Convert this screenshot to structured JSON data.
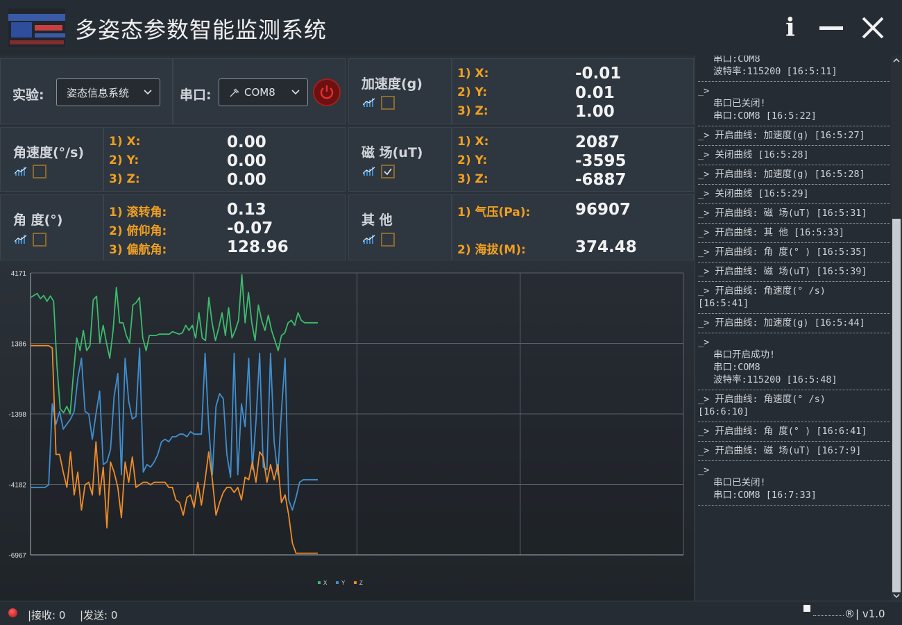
{
  "app": {
    "title": "多姿态参数智能监测系统"
  },
  "controls": {
    "experiment_label": "实验:",
    "experiment_value": "姿态信息系统",
    "port_label": "串口:",
    "port_value": "COM8"
  },
  "sensors": {
    "accel": {
      "label": "加速度(g)",
      "checked": false,
      "rows": [
        {
          "k": "1) X:",
          "v": "-0.01"
        },
        {
          "k": "2) Y:",
          "v": "0.01"
        },
        {
          "k": "3) Z:",
          "v": "1.00"
        }
      ]
    },
    "gyro": {
      "label": "角速度(°/s)",
      "checked": false,
      "rows": [
        {
          "k": "1) X:",
          "v": "0.00"
        },
        {
          "k": "2) Y:",
          "v": "0.00"
        },
        {
          "k": "3) Z:",
          "v": "0.00"
        }
      ]
    },
    "mag": {
      "label": "磁  场(uT)",
      "checked": true,
      "rows": [
        {
          "k": "1) X:",
          "v": "2087"
        },
        {
          "k": "2) Y:",
          "v": "-3595"
        },
        {
          "k": "3) Z:",
          "v": "-6887"
        }
      ]
    },
    "angle": {
      "label": "角  度(°)",
      "checked": false,
      "rows": [
        {
          "k": "1) 滚转角:",
          "v": "0.13"
        },
        {
          "k": "2) 俯仰角:",
          "v": "-0.07"
        },
        {
          "k": "3) 偏航角:",
          "v": "128.96"
        }
      ]
    },
    "other": {
      "label": "其  他",
      "checked": false,
      "rows": [
        {
          "k": "1) 气压(Pa):",
          "v": "96907"
        },
        {
          "k": "2) 海拔(M):",
          "v": "374.48"
        }
      ]
    }
  },
  "chart_data": {
    "type": "line",
    "yticks": [
      "4171",
      "1386",
      "-1398",
      "-4182",
      "-6967"
    ],
    "ylim": [
      -6967,
      4171
    ],
    "xlim": [
      0,
      200
    ],
    "grid": true,
    "legend_placement": "bottom-center",
    "series": [
      {
        "name": "X",
        "color": "#3dbb6d",
        "values": [
          3200,
          3280,
          3360,
          3150,
          3280,
          3050,
          3260,
          3050,
          500,
          -1200,
          -1350,
          -1100,
          -1400,
          200,
          1600,
          1100,
          1900,
          1100,
          1300,
          3100,
          3250,
          1400,
          2100,
          1400,
          800,
          1900,
          3600,
          2200,
          2200,
          1700,
          1400,
          2900,
          3000,
          3200,
          1600,
          1100,
          1700,
          1700,
          1700,
          1750,
          1750,
          1750,
          1750,
          1850,
          1800,
          1750,
          1800,
          2100,
          1900,
          2100,
          1600,
          2600,
          1600,
          1500,
          3200,
          2200,
          1500,
          2000,
          2600,
          1700,
          2800,
          1600,
          1900,
          2300,
          4100,
          2200,
          3400,
          2200,
          1500,
          2900,
          2300,
          1900,
          2500,
          1900,
          1500,
          1100,
          1700,
          1800,
          2200,
          2300,
          2100,
          2600,
          2300,
          2200,
          2200,
          2200,
          2200,
          2200
        ]
      },
      {
        "name": "Y",
        "color": "#3f8fd0",
        "values": [
          -4300,
          -4300,
          -4300,
          -4300,
          -4300,
          -4200,
          -1000,
          -1800,
          -1300,
          -2000,
          -1800,
          -1600,
          -1300,
          0,
          800,
          -1300,
          -1400,
          -2400,
          -1400,
          -500,
          -3400,
          -3300,
          -2800,
          -700,
          200,
          -3800,
          800,
          -900,
          -1600,
          -1500,
          1200,
          -3700,
          -3400,
          -3500,
          -3300,
          -3000,
          -2500,
          -2400,
          -2500,
          -2300,
          -2300,
          -2200,
          -2200,
          -2300,
          -2100,
          -2200,
          -2200,
          -2200,
          1000,
          -1900,
          -3800,
          -1100,
          -600,
          -800,
          -3000,
          -3900,
          1000,
          -3800,
          -1000,
          -1900,
          800,
          -3600,
          -1700,
          1000,
          -3500,
          -3600,
          1000,
          -2500,
          -3800,
          -1300,
          800,
          -4800,
          -5200,
          -4700,
          -4100,
          -4000,
          -4000,
          -4000,
          -4000,
          -4000
        ],
        "x_offset": 0
      },
      {
        "name": "Z",
        "color": "#f08c28",
        "values": [
          1300,
          1300,
          1300,
          1300,
          1300,
          1300,
          1200,
          -3000,
          -3000,
          -3700,
          -4300,
          -2900,
          -4600,
          -3700,
          -5200,
          -4200,
          -4100,
          -4600,
          -2500,
          -4600,
          -3500,
          -5900,
          -3300,
          -3700,
          -4300,
          -5500,
          -3300,
          -4100,
          -3100,
          -4300,
          -4200,
          -4100,
          -4100,
          -4200,
          -4100,
          -4100,
          -4100,
          -4100,
          -4300,
          -4300,
          -4800,
          -4900,
          -5400,
          -4700,
          -4600,
          -5100,
          -4100,
          -5000,
          -4000,
          -2900,
          -4000,
          -5400,
          -4900,
          -4500,
          -4300,
          -4300,
          -4500,
          -4300,
          -4800,
          -3900,
          -4000,
          -3300,
          -4100,
          -2900,
          -3100,
          -4100,
          -3400,
          -4000,
          -3400,
          -4900,
          -4600,
          -5400,
          -6500,
          -6900,
          -6900,
          -6900,
          -6900,
          -6900,
          -6900,
          -6900
        ]
      }
    ],
    "legend": [
      "X",
      "Y",
      "Z"
    ]
  },
  "log": [
    {
      "head": "",
      "lines": [
        "串口:COM8",
        "波特率:115200 [16:5:11]"
      ]
    },
    {
      "head": "_>",
      "lines": [
        "串口已关闭!",
        "串口:COM8 [16:5:22]"
      ]
    },
    {
      "head": "_> 开启曲线: 加速度(g) [16:5:27]",
      "lines": []
    },
    {
      "head": "_> 关闭曲线 [16:5:28]",
      "lines": []
    },
    {
      "head": "_> 开启曲线: 加速度(g) [16:5:28]",
      "lines": []
    },
    {
      "head": "_> 关闭曲线 [16:5:29]",
      "lines": []
    },
    {
      "head": "_> 开启曲线: 磁  场(uT) [16:5:31]",
      "lines": []
    },
    {
      "head": "_> 开启曲线: 其  他 [16:5:33]",
      "lines": []
    },
    {
      "head": "_> 开启曲线: 角  度(° ) [16:5:35]",
      "lines": []
    },
    {
      "head": "_> 开启曲线: 磁  场(uT) [16:5:39]",
      "lines": []
    },
    {
      "head": "_> 开启曲线: 角速度(° /s)",
      "lines": [],
      "tail": "[16:5:41]"
    },
    {
      "head": "_> 开启曲线: 加速度(g) [16:5:44]",
      "lines": []
    },
    {
      "head": "_>",
      "lines": [
        "串口开启成功!",
        "串口:COM8",
        "波特率:115200 [16:5:48]"
      ]
    },
    {
      "head": "_> 开启曲线: 角速度(° /s)",
      "lines": [],
      "tail": "[16:6:10]"
    },
    {
      "head": "_> 开启曲线: 角  度(° ) [16:6:41]",
      "lines": []
    },
    {
      "head": "_> 开启曲线: 磁  场(uT) [16:7:9]",
      "lines": []
    },
    {
      "head": "_>",
      "lines": [
        "串口已关闭!",
        "串口:COM8 [16:7:33]"
      ]
    }
  ],
  "status": {
    "receive": "|接收:  0",
    "send": "|发送:  0",
    "brand": "®",
    "version": "| v1.0"
  }
}
